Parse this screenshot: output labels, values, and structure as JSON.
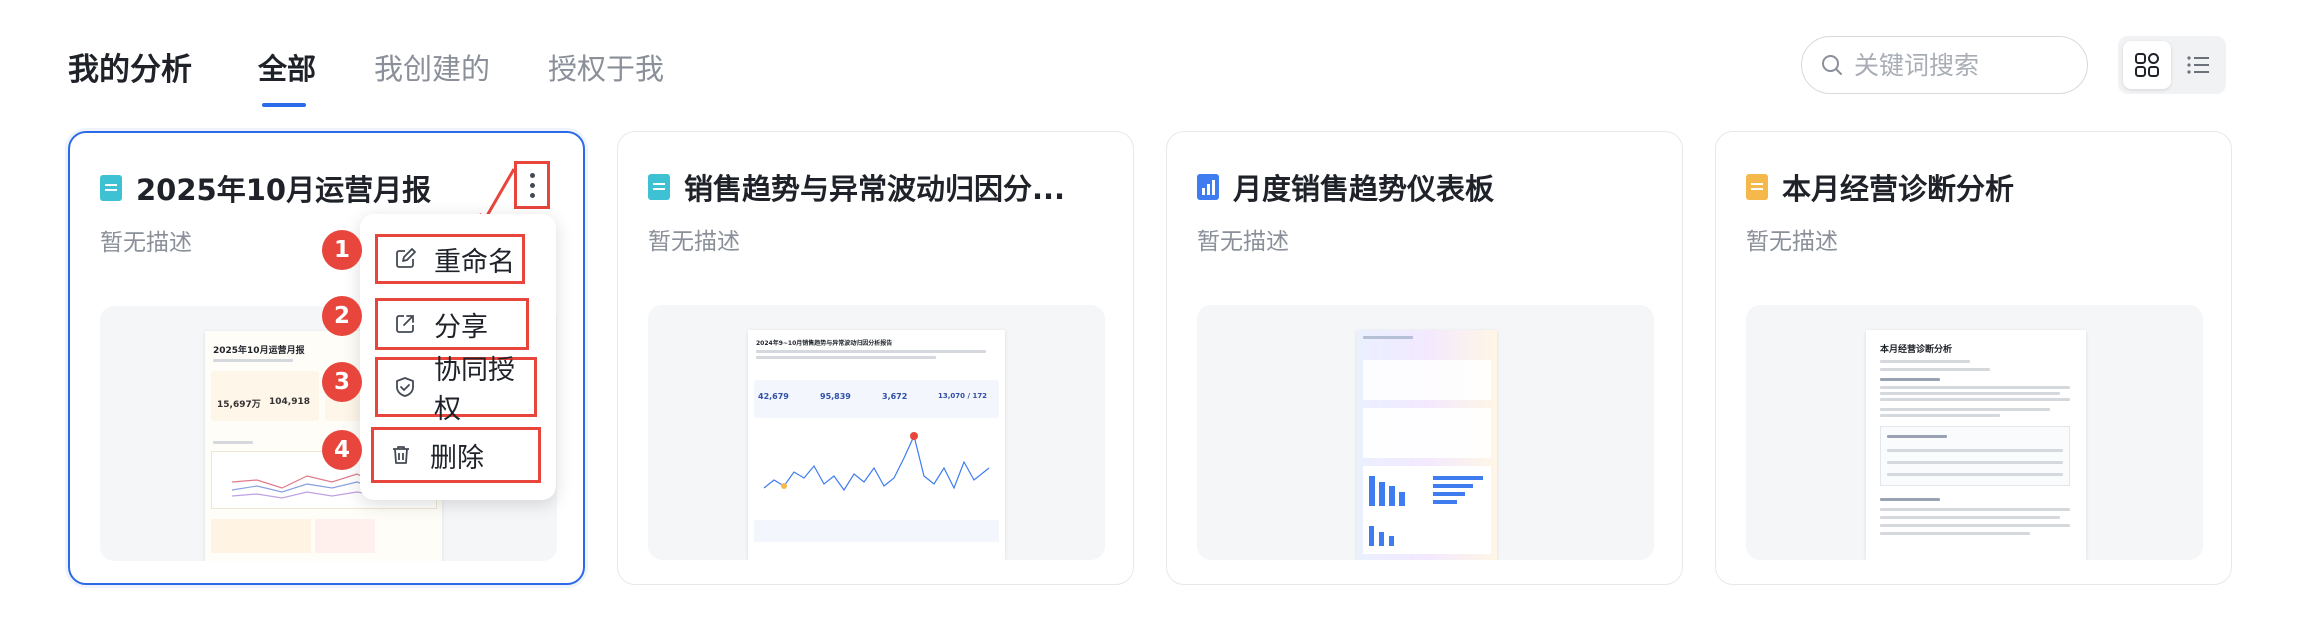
{
  "header": {
    "title": "我的分析",
    "tabs": [
      {
        "label": "全部",
        "active": true
      },
      {
        "label": "我创建的",
        "active": false
      },
      {
        "label": "授权于我",
        "active": false
      }
    ],
    "search_placeholder": "关键词搜索",
    "view_modes": [
      "grid-icon",
      "list-icon"
    ]
  },
  "cards": [
    {
      "title": "2025年10月运营月报",
      "description": "暂无描述",
      "icon": "document-icon",
      "icon_color": "#3ec1d3",
      "thumb_title": "2025年10月运营月报",
      "thumb_values": [
        "15,697万",
        "104,918"
      ]
    },
    {
      "title": "销售趋势与异常波动归因分...",
      "description": "暂无描述",
      "icon": "document-icon",
      "icon_color": "#3ec1d3",
      "thumb_title": "2024年9~10月销售趋势与异常波动归因分析报告",
      "thumb_values": [
        "42,679",
        "95,839",
        "3,672",
        "13,070 / 172"
      ]
    },
    {
      "title": "月度销售趋势仪表板",
      "description": "暂无描述",
      "icon": "dashboard-icon",
      "icon_color": "#3f7cf0"
    },
    {
      "title": "本月经营诊断分析",
      "description": "暂无描述",
      "icon": "document-icon",
      "icon_color": "#f5b94b",
      "thumb_title": "本月经营诊断分析"
    }
  ],
  "menu": {
    "items": [
      {
        "number": "1",
        "label": "重命名",
        "icon": "edit-icon"
      },
      {
        "number": "2",
        "label": "分享",
        "icon": "share-icon"
      },
      {
        "number": "3",
        "label": "协同授权",
        "icon": "shield-icon"
      },
      {
        "number": "4",
        "label": "删除",
        "icon": "trash-icon"
      }
    ]
  },
  "colors": {
    "accent": "#2b6be8",
    "annotation": "#e8453c"
  }
}
